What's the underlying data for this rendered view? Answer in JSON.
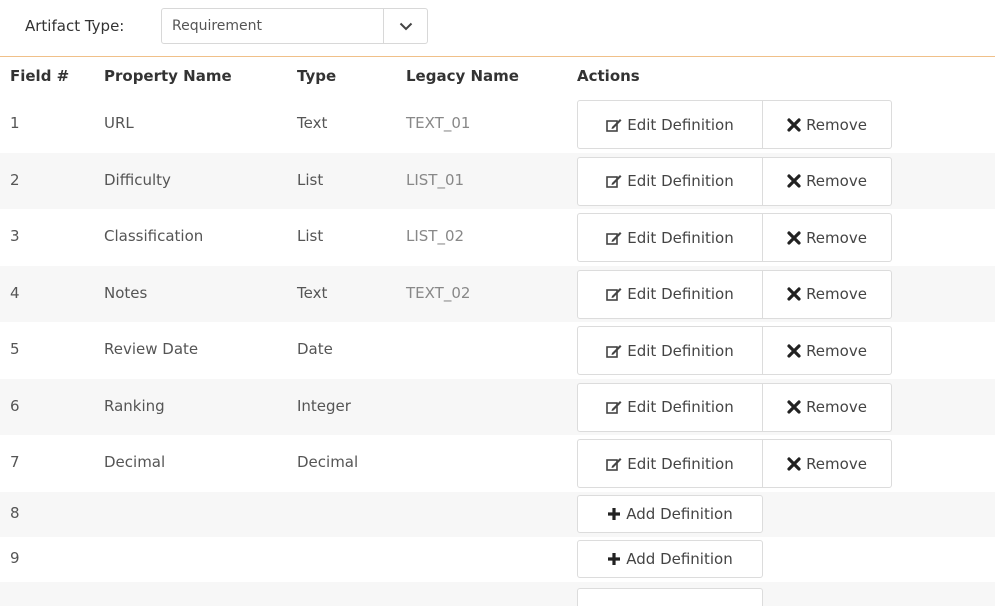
{
  "filter": {
    "label": "Artifact Type:",
    "selected": "Requirement"
  },
  "table": {
    "headers": {
      "field": "Field #",
      "property": "Property Name",
      "type": "Type",
      "legacy": "Legacy Name",
      "actions": "Actions"
    },
    "edit_label": "Edit Definition",
    "remove_label": "Remove",
    "add_label": "Add Definition",
    "rows": [
      {
        "field": "1",
        "property": "URL",
        "type": "Text",
        "legacy": "TEXT_01"
      },
      {
        "field": "2",
        "property": "Difficulty",
        "type": "List",
        "legacy": "LIST_01"
      },
      {
        "field": "3",
        "property": "Classification",
        "type": "List",
        "legacy": "LIST_02"
      },
      {
        "field": "4",
        "property": "Notes",
        "type": "Text",
        "legacy": "TEXT_02"
      },
      {
        "field": "5",
        "property": "Review Date",
        "type": "Date",
        "legacy": ""
      },
      {
        "field": "6",
        "property": "Ranking",
        "type": "Integer",
        "legacy": ""
      },
      {
        "field": "7",
        "property": "Decimal",
        "type": "Decimal",
        "legacy": ""
      },
      {
        "field": "8",
        "property": "",
        "type": "",
        "legacy": ""
      },
      {
        "field": "9",
        "property": "",
        "type": "",
        "legacy": ""
      }
    ]
  },
  "icons": {
    "edit": "edit-icon",
    "remove": "x-icon",
    "add": "plus-icon",
    "dropdown": "chevron-down-icon"
  }
}
